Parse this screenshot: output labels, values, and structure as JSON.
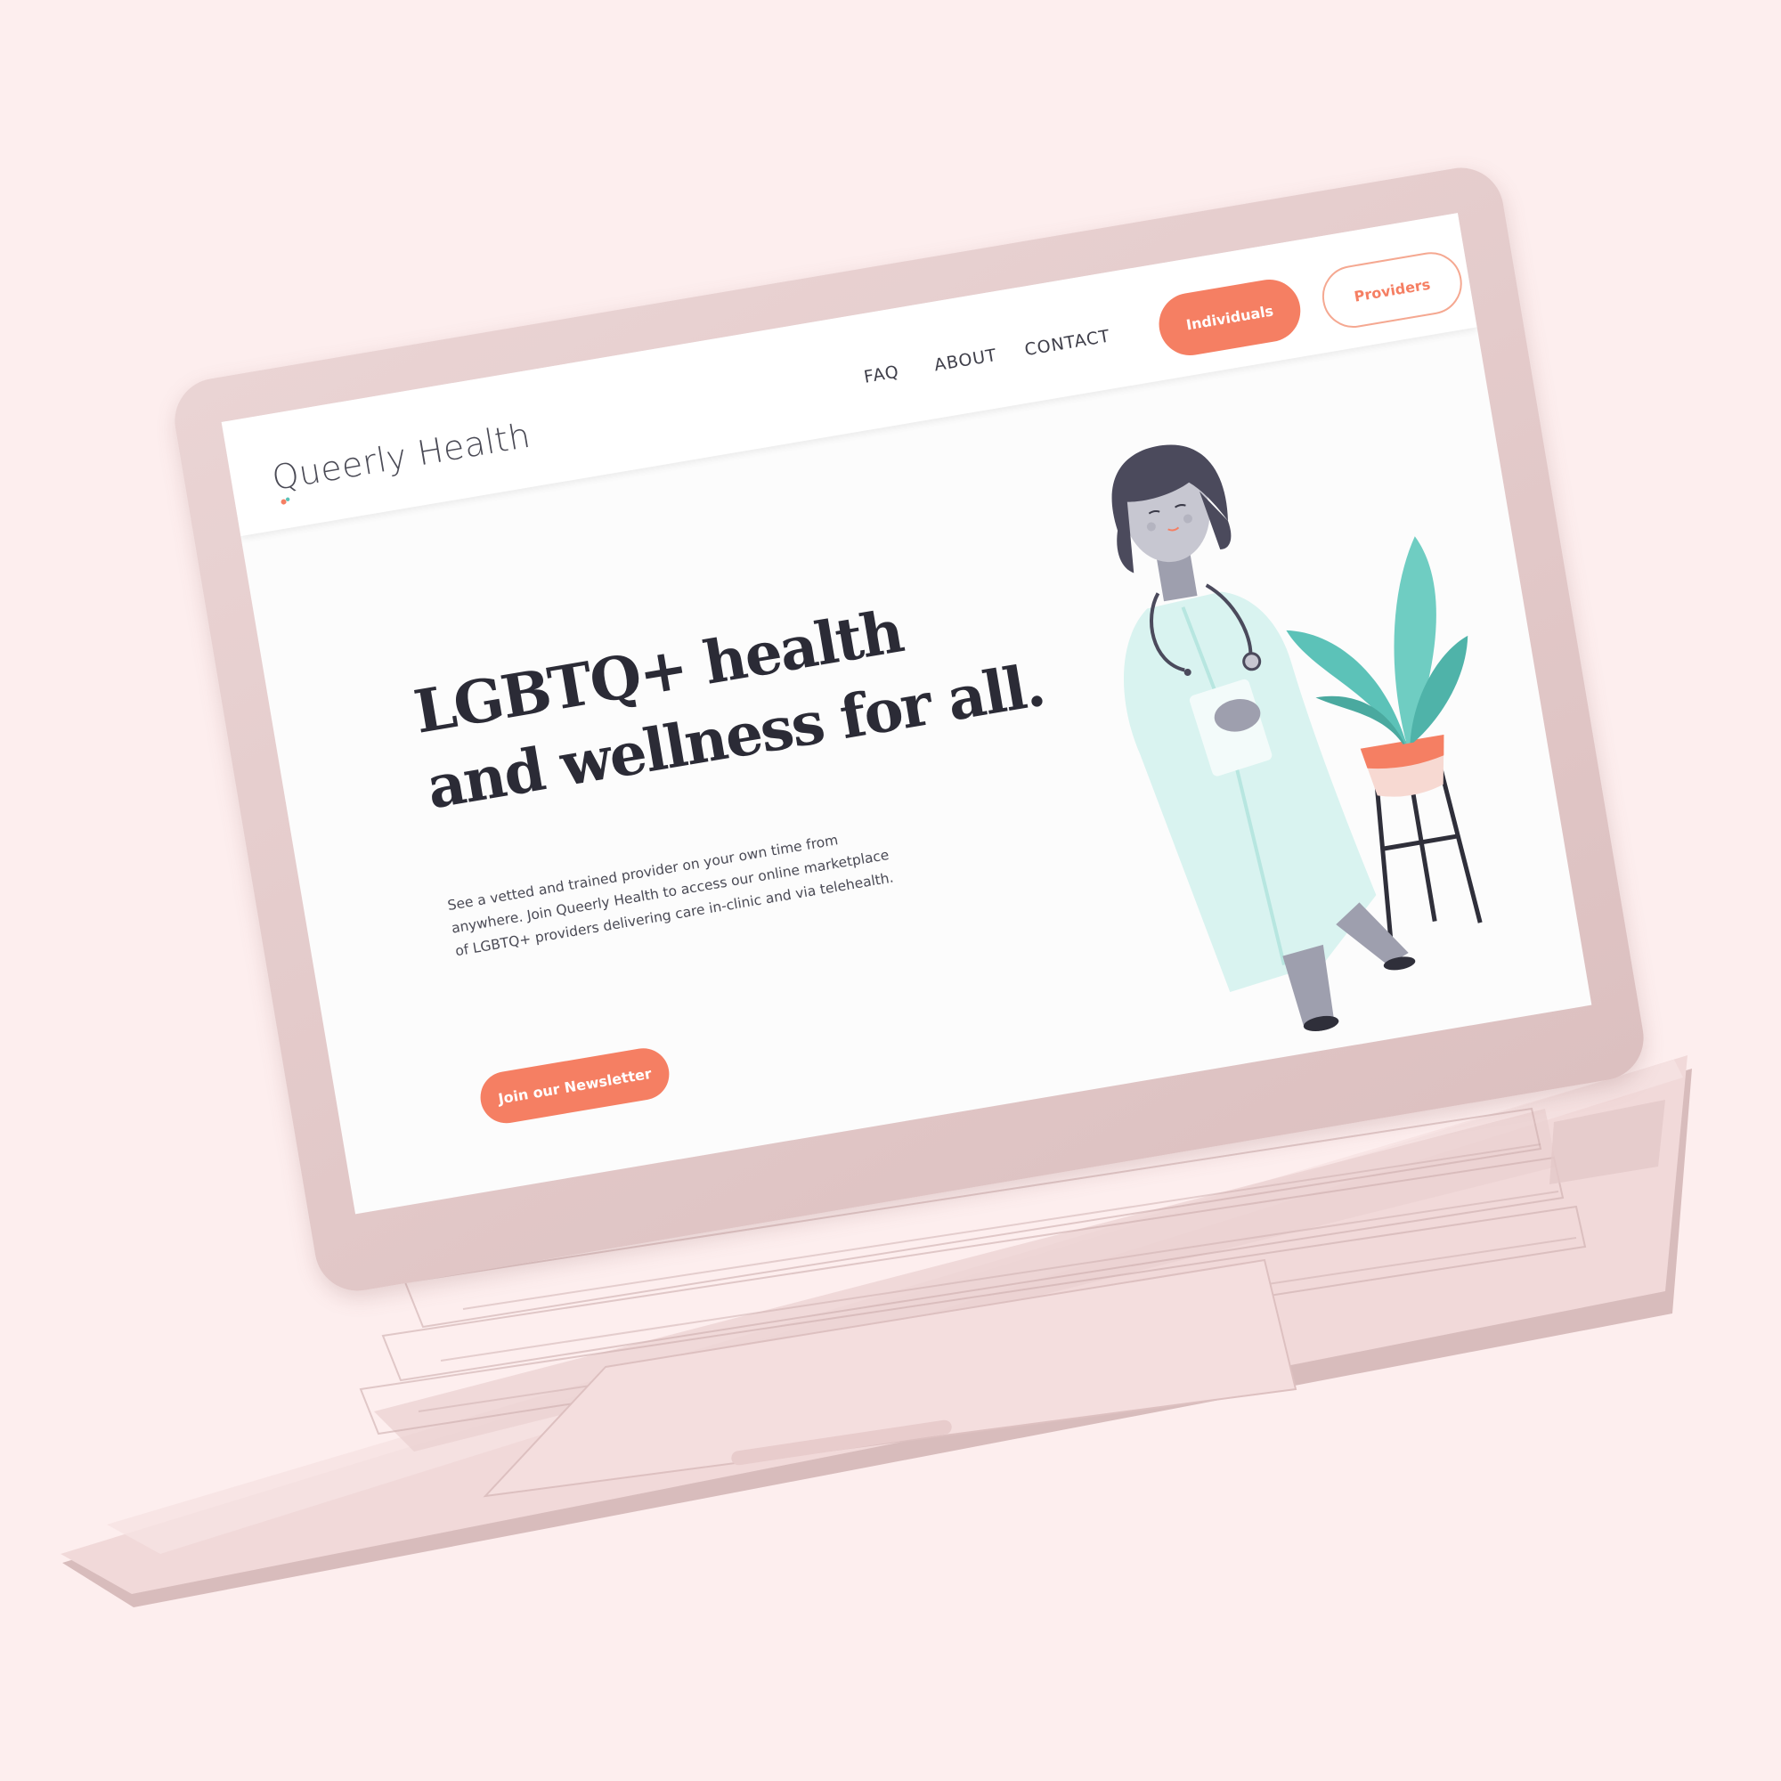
{
  "site": {
    "logo_text": "Queerly Health"
  },
  "nav": {
    "items": [
      "FAQ",
      "ABOUT",
      "CONTACT"
    ]
  },
  "cta": {
    "individuals_label": "Individuals",
    "providers_label": "Providers"
  },
  "hero": {
    "title_lines": [
      "LGBTQ+ health",
      "and wellness for all."
    ],
    "description_lines": [
      "See a vetted and trained provider on your own time from",
      "anywhere. Join Queerly Health to access our online marketplace",
      "of LGBTQ+ providers delivering care in-clinic and via telehealth."
    ],
    "newsletter_label": "Join our Newsletter"
  },
  "colors": {
    "background": "#fdeeee",
    "laptop_lid": "#e2c8c8",
    "laptop_base": "#f3dcdc",
    "accent": "#f57f63",
    "text_dark": "#2b2b36",
    "coat": "#d9f3f0",
    "leaf": "#5cc2b8",
    "hair": "#4b4a5c"
  },
  "icons": [
    "logo-mark-icon",
    "stethoscope-icon",
    "plant-icon"
  ]
}
